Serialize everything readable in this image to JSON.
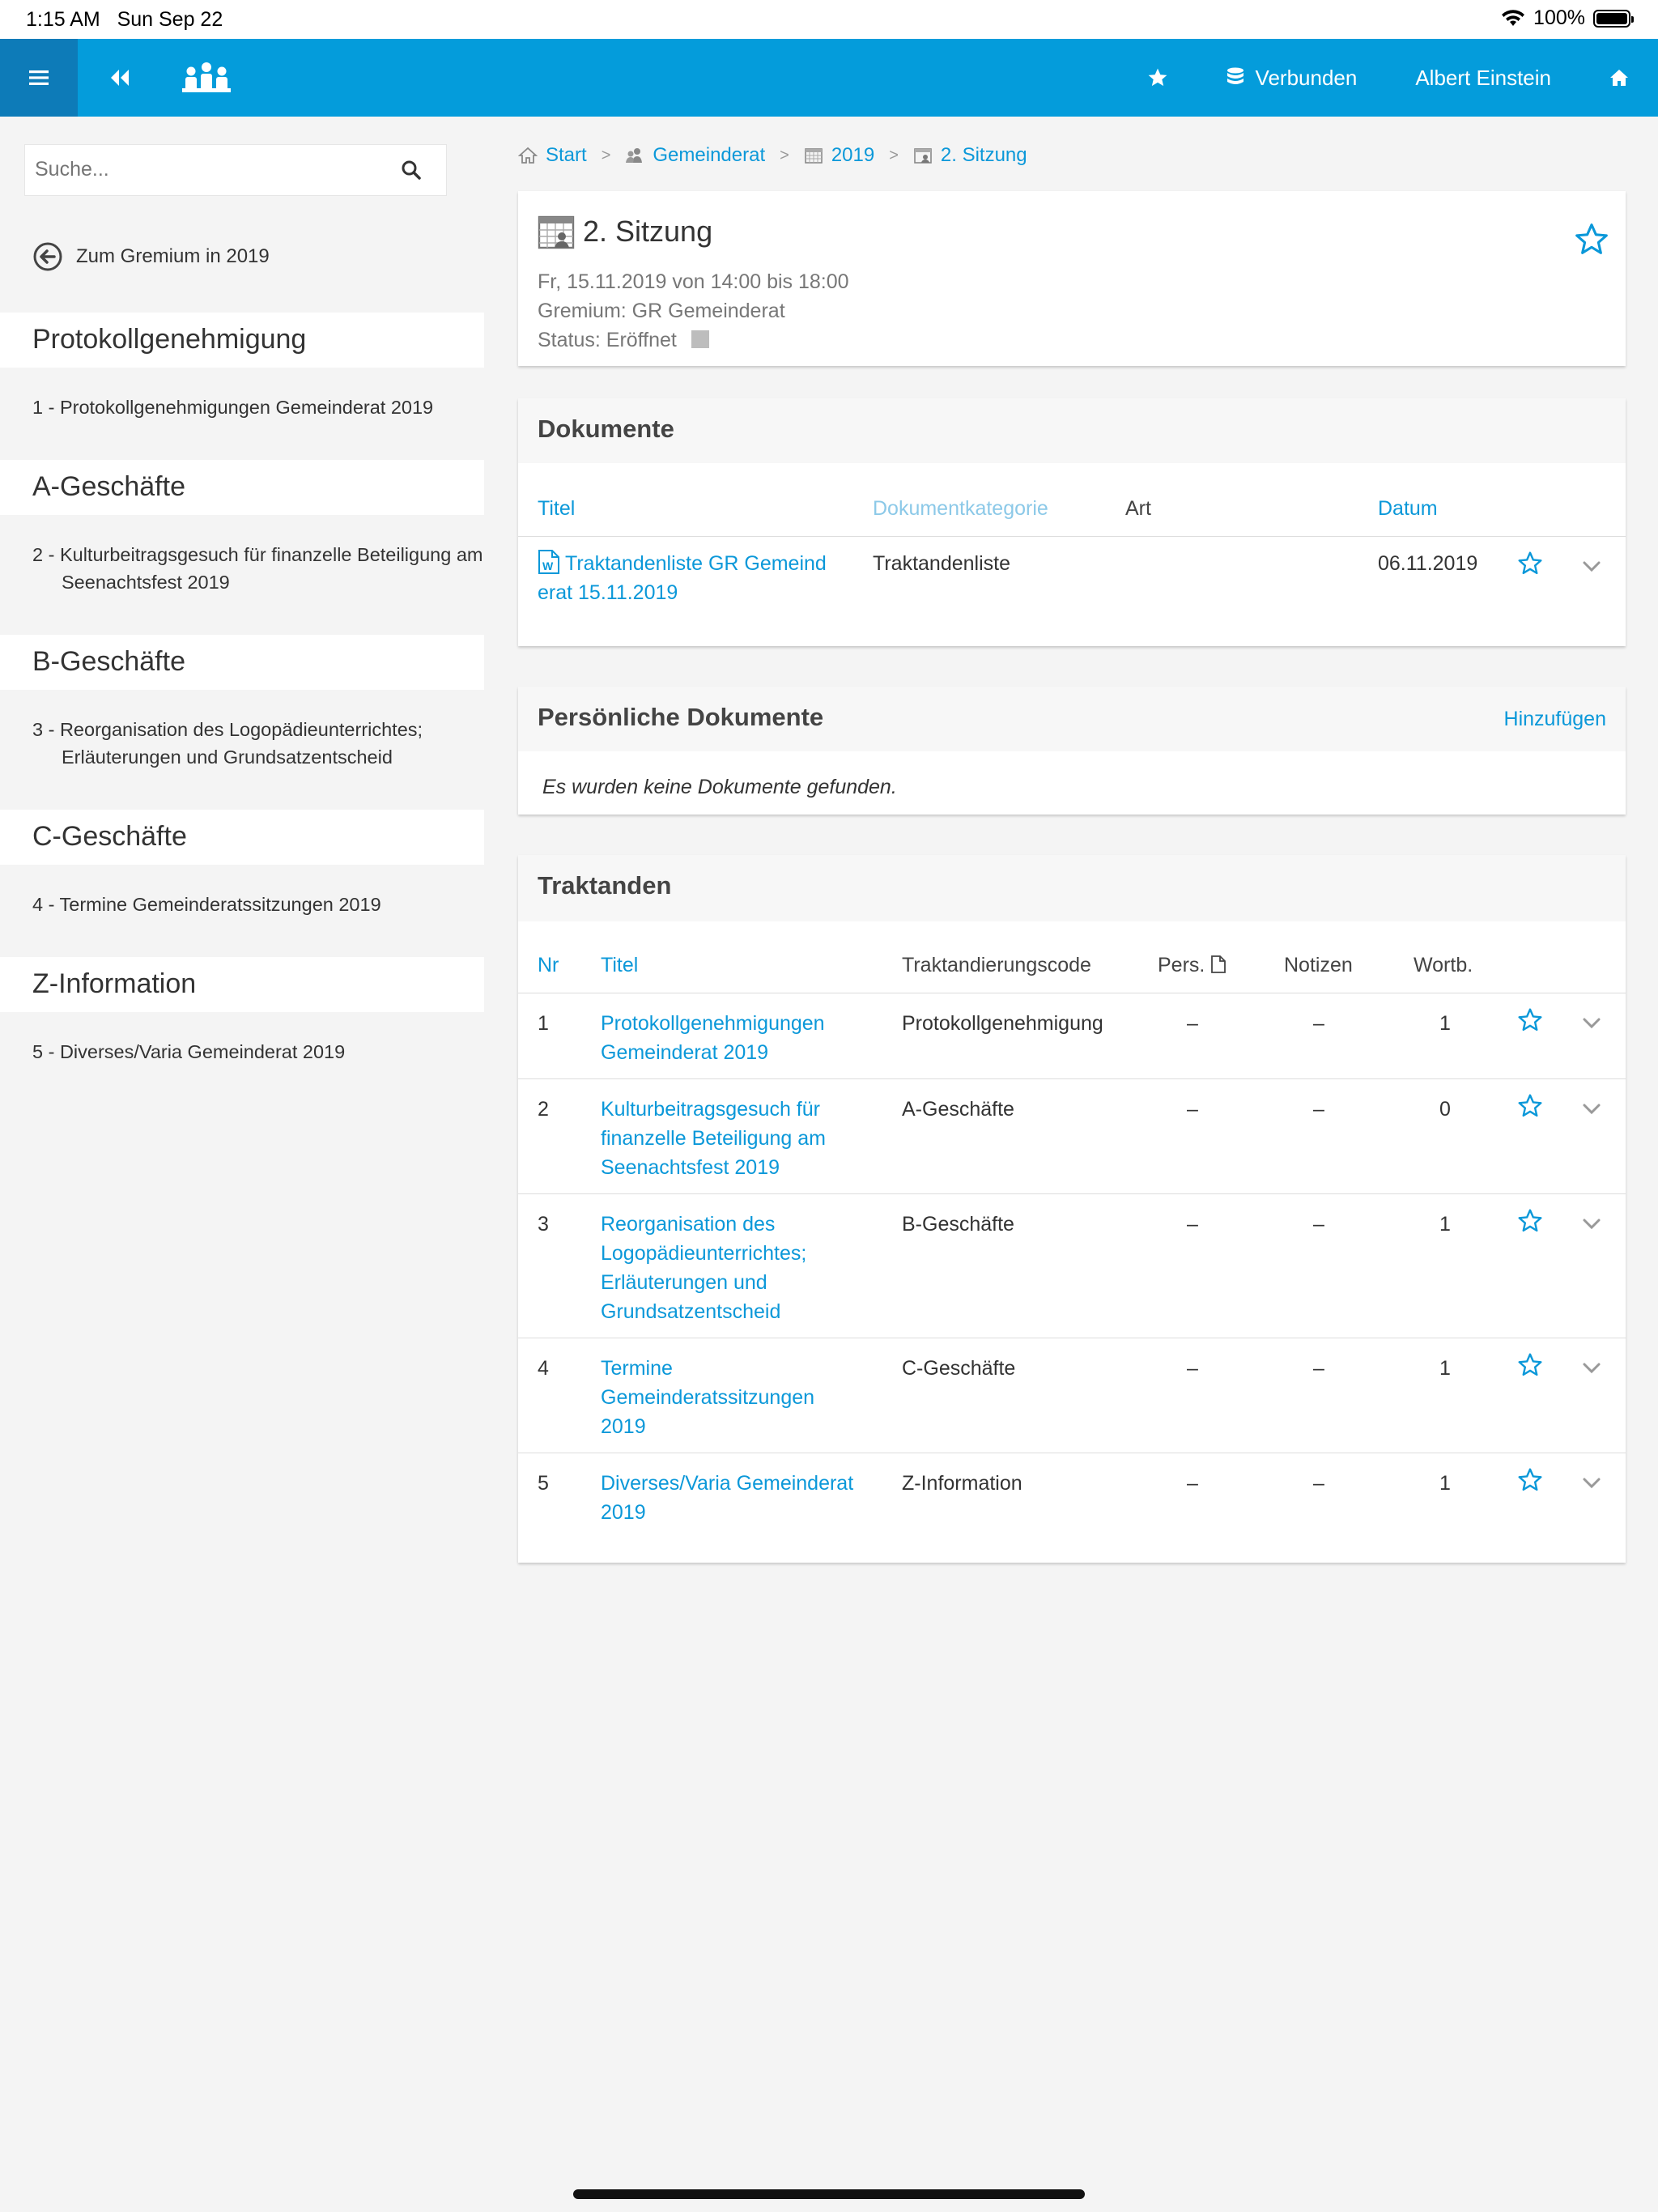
{
  "status_bar": {
    "time": "1:15 AM",
    "date": "Sun Sep 22",
    "battery": "100%"
  },
  "topnav": {
    "connected_label": "Verbunden",
    "user_name": "Albert Einstein"
  },
  "sidebar": {
    "search_placeholder": "Suche...",
    "back_label": "Zum Gremium in 2019",
    "groups": [
      {
        "title": "Protokollgenehmigung",
        "items": [
          "1 - Protokollgenehmigungen Gemeinderat 2019"
        ]
      },
      {
        "title": "A-Geschäfte",
        "items": [
          "2 - Kulturbeitragsgesuch für finanzelle Beteiligung am Seenachtsfest 2019"
        ]
      },
      {
        "title": "B-Geschäfte",
        "items": [
          "3 - Reorganisation des Logopädieunterrichtes; Erläuterungen und Grundsatzentscheid"
        ]
      },
      {
        "title": "C-Geschäfte",
        "items": [
          "4 - Termine Gemeinderatssitzungen 2019"
        ]
      },
      {
        "title": "Z-Information",
        "items": [
          "5 - Diverses/Varia Gemeinderat 2019"
        ]
      }
    ]
  },
  "breadcrumb": [
    "Start",
    "Gemeinderat",
    "2019",
    "2. Sitzung"
  ],
  "meeting": {
    "title": "2. Sitzung",
    "datetime": "Fr, 15.11.2019 von 14:00 bis 18:00",
    "gremium": "Gremium: GR Gemeinderat",
    "status": "Status: Eröffnet"
  },
  "documents": {
    "title": "Dokumente",
    "columns": {
      "titel": "Titel",
      "kategorie": "Dokumentkategorie",
      "art": "Art",
      "datum": "Datum"
    },
    "rows": [
      {
        "titel_line1": "Traktandenliste GR Gemeind",
        "titel_line2": "erat 15.11.2019",
        "kategorie": "Traktandenliste",
        "art": "",
        "datum": "06.11.2019"
      }
    ]
  },
  "personal_documents": {
    "title": "Persönliche Dokumente",
    "add_label": "Hinzufügen",
    "empty_message": "Es wurden keine Dokumente gefunden."
  },
  "agenda": {
    "title": "Traktanden",
    "columns": {
      "nr": "Nr",
      "titel": "Titel",
      "code": "Traktandierungscode",
      "pers": "Pers.",
      "notizen": "Notizen",
      "wortb": "Wortb."
    },
    "rows": [
      {
        "nr": "1",
        "titel": [
          "Protokollgenehmigungen",
          "Gemeinderat 2019"
        ],
        "code": "Protokollgenehmigung",
        "pers": "–",
        "notizen": "–",
        "wortb": "1"
      },
      {
        "nr": "2",
        "titel": [
          "Kulturbeitragsgesuch für",
          "finanzelle Beteiligung am",
          "Seenachtsfest 2019"
        ],
        "code": "A-Geschäfte",
        "pers": "–",
        "notizen": "–",
        "wortb": "0"
      },
      {
        "nr": "3",
        "titel": [
          "Reorganisation des",
          "Logopädieunterrichtes;",
          "Erläuterungen und",
          "Grundsatzentscheid"
        ],
        "code": "B-Geschäfte",
        "pers": "–",
        "notizen": "–",
        "wortb": "1"
      },
      {
        "nr": "4",
        "titel": [
          "Termine",
          "Gemeinderatssitzungen",
          "2019"
        ],
        "code": "C-Geschäfte",
        "pers": "–",
        "notizen": "–",
        "wortb": "1"
      },
      {
        "nr": "5",
        "titel": [
          "Diverses/Varia Gemeinderat",
          "2019"
        ],
        "code": "Z-Information",
        "pers": "–",
        "notizen": "–",
        "wortb": "1"
      }
    ]
  },
  "colors": {
    "brand": "#049cdb",
    "brand_dark": "#0d7bb8",
    "link": "#0b98d9",
    "background": "#f4f4f4"
  }
}
